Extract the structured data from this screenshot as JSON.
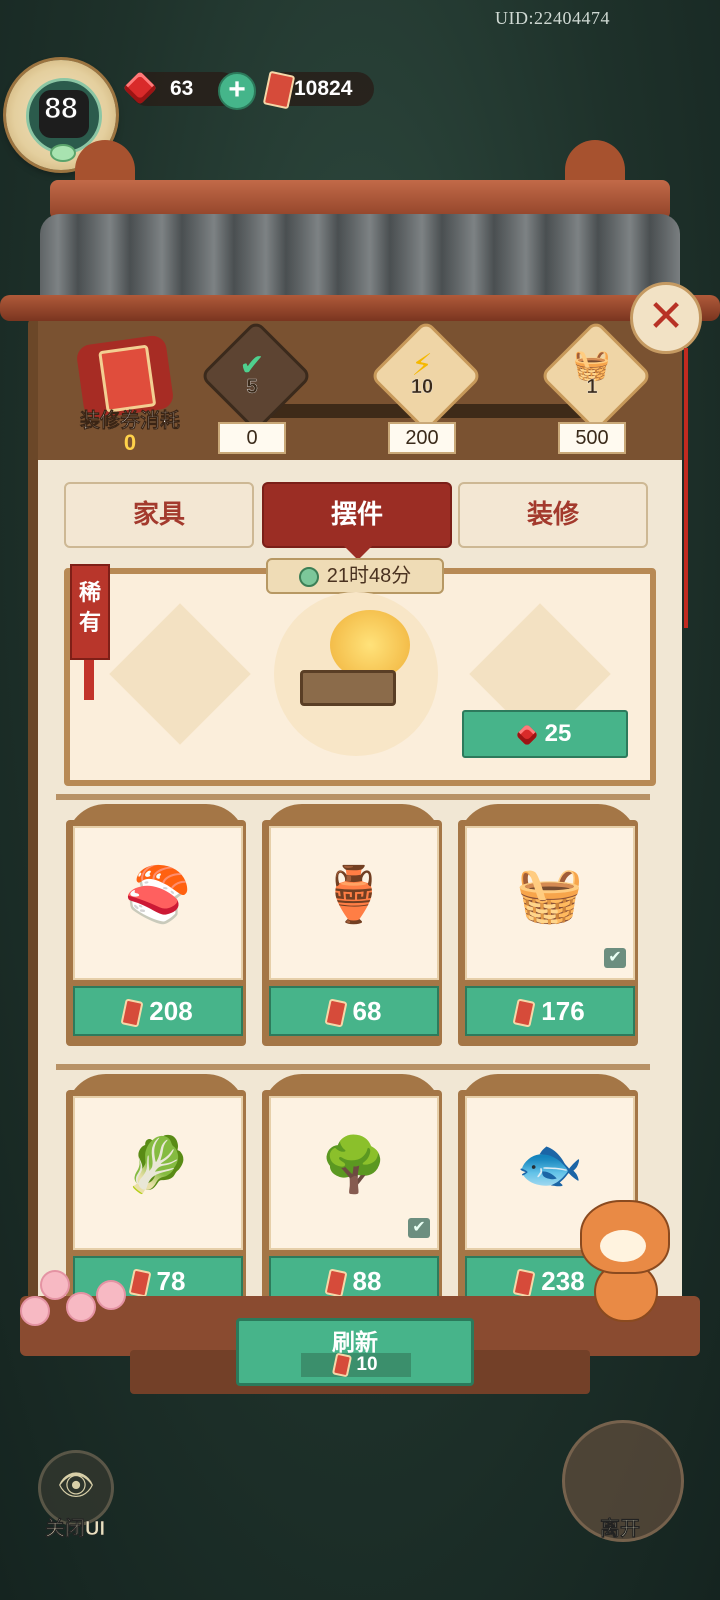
{
  "header": {
    "uid": "UID:22404474",
    "level": "88",
    "gems": "63",
    "tickets": "10824"
  },
  "cost_panel": {
    "label": "装修券消耗",
    "value": "0"
  },
  "milestones": [
    {
      "count": "5",
      "threshold": "0",
      "icon": "check-chest-icon",
      "claimed": true
    },
    {
      "count": "10",
      "threshold": "200",
      "icon": "lightning-icon",
      "claimed": false
    },
    {
      "count": "1",
      "threshold": "500",
      "icon": "basket-gift-icon",
      "claimed": false
    }
  ],
  "tabs": [
    {
      "label": "家具"
    },
    {
      "label": "摆件",
      "active": true
    },
    {
      "label": "装修"
    }
  ],
  "featured": {
    "rarity": "稀有",
    "timer": "21时48分",
    "price": "25",
    "icon": "golden-bonsai-icon"
  },
  "items": [
    {
      "price": "208",
      "icon": "koi-dish-icon",
      "owned": false
    },
    {
      "price": "68",
      "icon": "plant-vase-icon",
      "owned": false
    },
    {
      "price": "176",
      "icon": "fruit-basket-icon",
      "owned": true
    },
    {
      "price": "78",
      "icon": "vegetable-basket-icon",
      "owned": false
    },
    {
      "price": "88",
      "icon": "bonsai-books-icon",
      "owned": true
    },
    {
      "price": "238",
      "icon": "goldfish-icon",
      "owned": false
    }
  ],
  "refresh": {
    "label": "刷新",
    "cost": "10"
  },
  "bottom": {
    "hide_ui_label": "关闭UI",
    "leave_label": "离开"
  },
  "colors": {
    "accent_green": "#47b48a",
    "tab_active": "#9b2d24",
    "gem_red": "#d92a2a"
  }
}
